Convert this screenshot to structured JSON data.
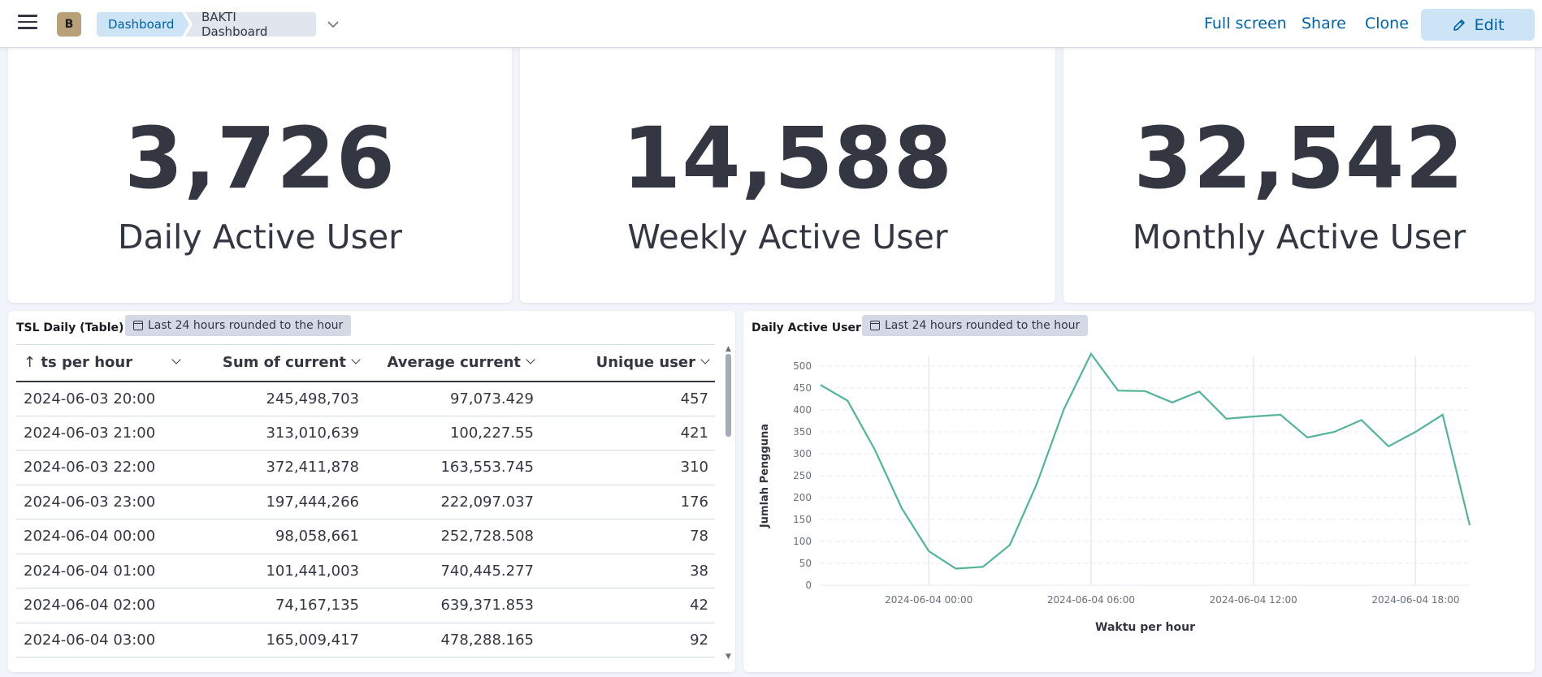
{
  "header": {
    "avatar_initial": "B",
    "breadcrumbs": [
      "Dashboard",
      "BAKTI Dashboard"
    ],
    "actions": {
      "fullscreen": "Full screen",
      "share": "Share",
      "clone": "Clone",
      "edit": "Edit"
    }
  },
  "metrics": [
    {
      "value": "3,726",
      "label": "Daily Active User"
    },
    {
      "value": "14,588",
      "label": "Weekly Active User"
    },
    {
      "value": "32,542",
      "label": "Monthly Active User"
    }
  ],
  "table_panel": {
    "title": "TSL Daily (Table)",
    "time_range": "Last 24 hours rounded to the hour",
    "columns": [
      "ts per hour",
      "Sum of current",
      "Average current",
      "Unique user"
    ],
    "rows": [
      [
        "2024-06-03 20:00",
        "245,498,703",
        "97,073.429",
        "457"
      ],
      [
        "2024-06-03 21:00",
        "313,010,639",
        "100,227.55",
        "421"
      ],
      [
        "2024-06-03 22:00",
        "372,411,878",
        "163,553.745",
        "310"
      ],
      [
        "2024-06-03 23:00",
        "197,444,266",
        "222,097.037",
        "176"
      ],
      [
        "2024-06-04 00:00",
        "98,058,661",
        "252,728.508",
        "78"
      ],
      [
        "2024-06-04 01:00",
        "101,441,003",
        "740,445.277",
        "38"
      ],
      [
        "2024-06-04 02:00",
        "74,167,135",
        "639,371.853",
        "42"
      ],
      [
        "2024-06-04 03:00",
        "165,009,417",
        "478,288.165",
        "92"
      ]
    ]
  },
  "chart_panel": {
    "title": "Daily Active User",
    "time_range": "Last 24 hours rounded to the hour"
  },
  "chart_data": {
    "type": "line",
    "xlabel": "Waktu per hour",
    "ylabel": "Jumlah Pengguna",
    "ylim": [
      0,
      500
    ],
    "yticks": [
      0,
      50,
      100,
      150,
      200,
      250,
      300,
      350,
      400,
      450,
      500
    ],
    "xticks": [
      "2024-06-04 00:00",
      "2024-06-04 06:00",
      "2024-06-04 12:00",
      "2024-06-04 18:00"
    ],
    "x": [
      "2024-06-03 20:00",
      "2024-06-03 21:00",
      "2024-06-03 22:00",
      "2024-06-03 23:00",
      "2024-06-04 00:00",
      "2024-06-04 01:00",
      "2024-06-04 02:00",
      "2024-06-04 03:00",
      "2024-06-04 04:00",
      "2024-06-04 05:00",
      "2024-06-04 06:00",
      "2024-06-04 07:00",
      "2024-06-04 08:00",
      "2024-06-04 09:00",
      "2024-06-04 10:00",
      "2024-06-04 11:00",
      "2024-06-04 12:00",
      "2024-06-04 13:00",
      "2024-06-04 14:00",
      "2024-06-04 15:00",
      "2024-06-04 16:00",
      "2024-06-04 17:00",
      "2024-06-04 18:00",
      "2024-06-04 19:00",
      "2024-06-04 20:00"
    ],
    "series": [
      {
        "values": [
          457,
          421,
          310,
          176,
          78,
          38,
          42,
          92,
          232,
          402,
          528,
          444,
          443,
          417,
          442,
          380,
          385,
          389,
          337,
          350,
          377,
          317,
          350,
          389,
          137
        ]
      }
    ],
    "grid": true,
    "line_color": "#54b399"
  }
}
